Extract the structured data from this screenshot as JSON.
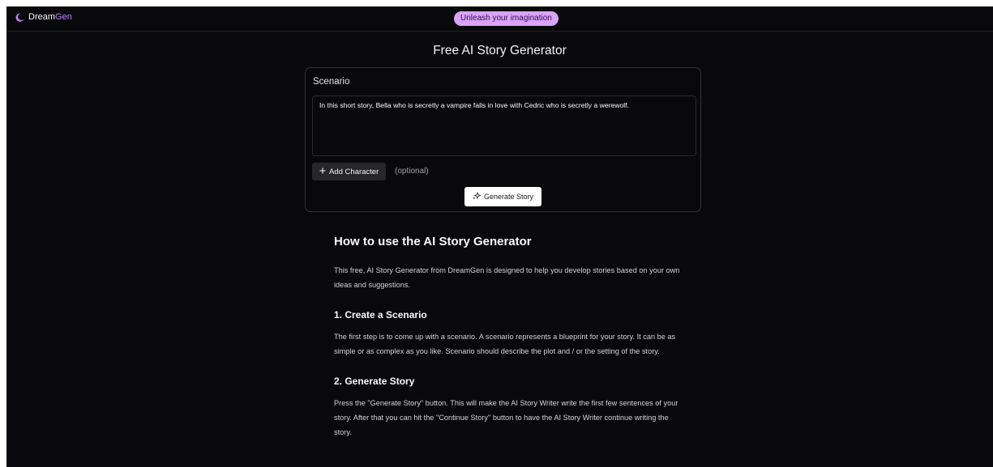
{
  "header": {
    "brand_prefix": "Dream",
    "brand_suffix": "Gen",
    "tagline": "Unleash your imagination"
  },
  "main": {
    "title": "Free AI Story Generator",
    "scenario_label": "Scenario",
    "scenario_value": "In this short story, Bella who is secretly a vampire falls in love with Cedric who is secretly a werewolf.",
    "add_character_label": "Add Character",
    "optional_note": "(optional)",
    "generate_label": "Generate Story"
  },
  "article": {
    "heading": "How to use the AI Story Generator",
    "intro": "This free, AI Story Generator from DreamGen is designed to help you develop stories based on your own ideas and suggestions.",
    "steps": [
      {
        "title": "1. Create a Scenario",
        "body": "The first step is to come up with a scenario. A scenario represents a blueprint for your story. It can be as simple or as complex as you like. Scenario should describe the plot and / or the setting of the story."
      },
      {
        "title": "2. Generate Story",
        "body": "Press the \"Generate Story\" button. This will make the AI Story Writer write the first few sentences of your story. After that you can hit the \"Continue Story\" button to have the AI Story Writer continue writing the story."
      }
    ]
  },
  "icons": {
    "logo": "crescent-moon-icon",
    "add": "plus-icon",
    "generate": "sparkles-icon"
  },
  "colors": {
    "background": "#09090b",
    "accent": "#c084fc",
    "tagline_bg": "#d8a4f5"
  }
}
